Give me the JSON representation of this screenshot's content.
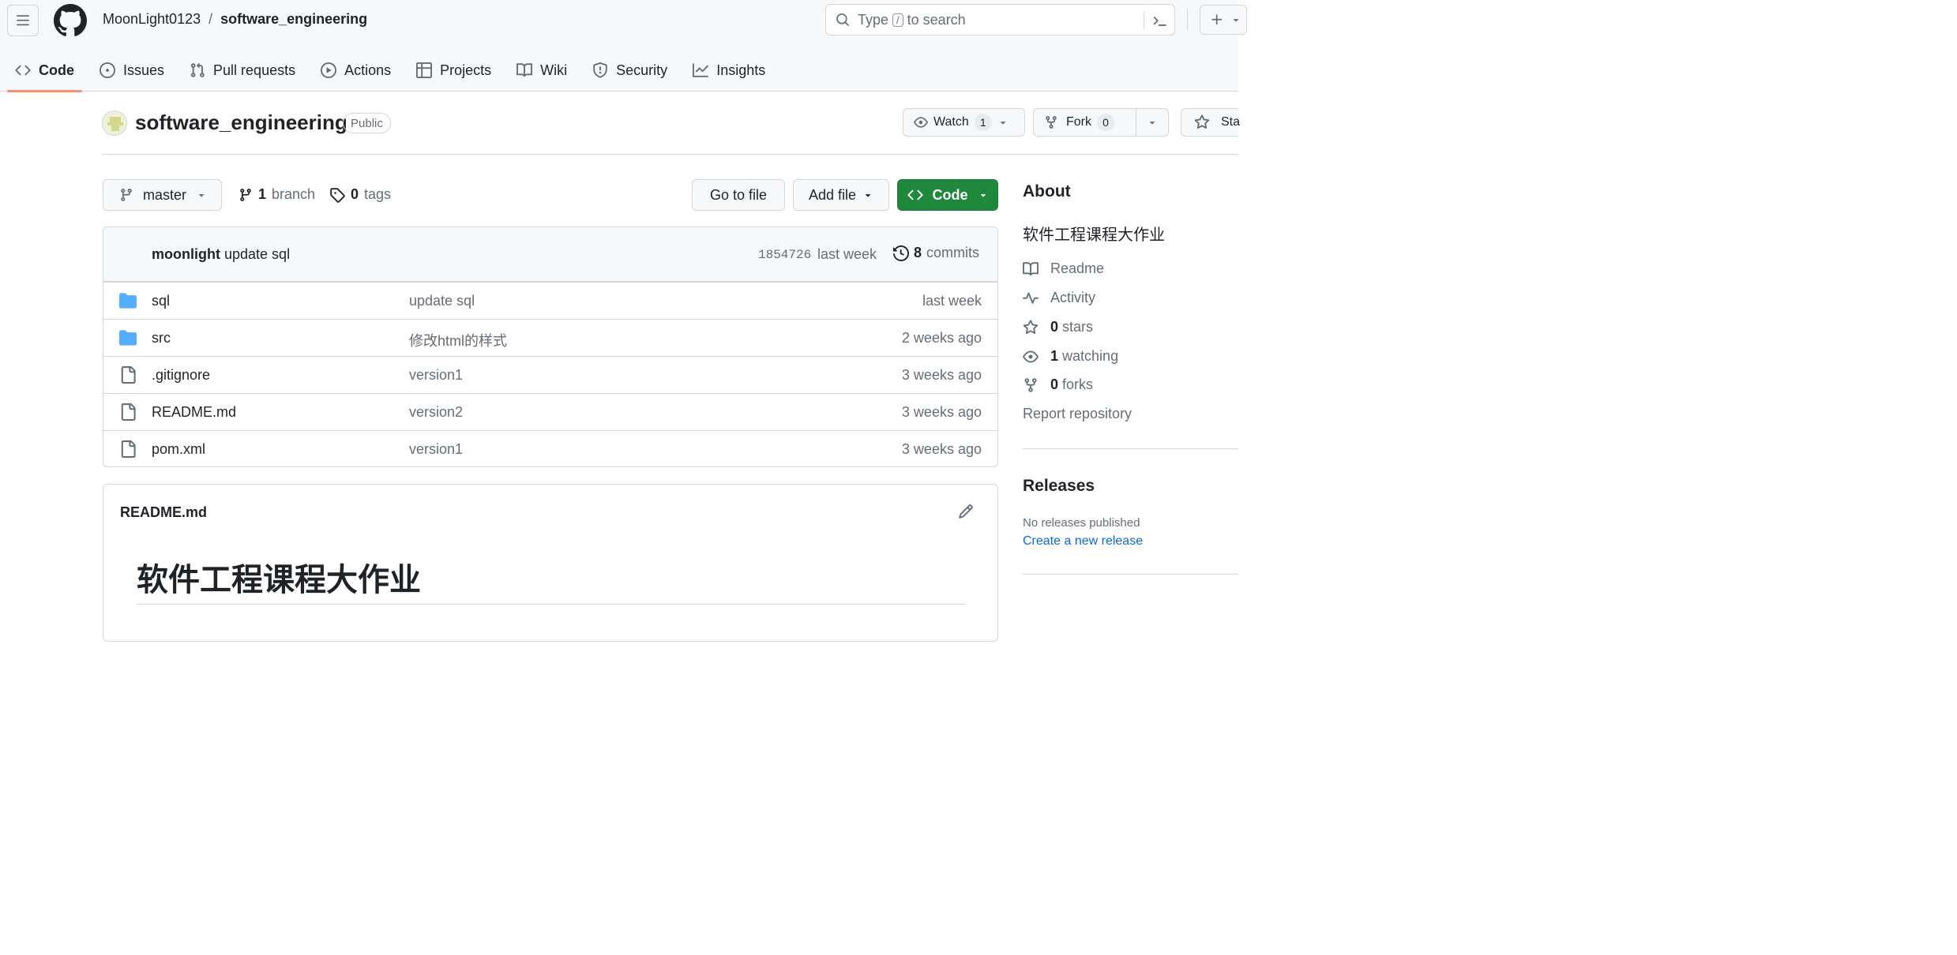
{
  "header": {
    "owner": "MoonLight0123",
    "separator": "/",
    "repo": "software_engineering",
    "search_prefix": "Type",
    "search_key": "/",
    "search_suffix": "to search"
  },
  "tabs": [
    {
      "label": "Code",
      "icon": "code-icon",
      "active": true
    },
    {
      "label": "Issues",
      "icon": "issue-icon"
    },
    {
      "label": "Pull requests",
      "icon": "pull-request-icon"
    },
    {
      "label": "Actions",
      "icon": "play-icon"
    },
    {
      "label": "Projects",
      "icon": "table-icon"
    },
    {
      "label": "Wiki",
      "icon": "book-icon"
    },
    {
      "label": "Security",
      "icon": "shield-icon"
    },
    {
      "label": "Insights",
      "icon": "graph-icon"
    }
  ],
  "repo_title": {
    "name": "software_engineering",
    "visibility": "Public",
    "watch_label": "Watch",
    "watch_count": "1",
    "fork_label": "Fork",
    "fork_count": "0",
    "star_label": "Sta"
  },
  "branch_bar": {
    "branch": "master",
    "branch_count": "1",
    "branch_label": "branch",
    "tag_count": "0",
    "tag_label": "tags",
    "go_to_file": "Go to file",
    "add_file": "Add file",
    "code": "Code"
  },
  "latest_commit": {
    "author": "moonlight",
    "message": "update sql",
    "sha": "1854726",
    "when": "last week",
    "count": "8",
    "count_label": "commits"
  },
  "files": [
    {
      "type": "folder",
      "name": "sql",
      "message": "update sql",
      "age": "last week"
    },
    {
      "type": "folder",
      "name": "src",
      "message": "修改html的样式",
      "age": "2 weeks ago"
    },
    {
      "type": "file",
      "name": ".gitignore",
      "message": "version1",
      "age": "3 weeks ago"
    },
    {
      "type": "file",
      "name": "README.md",
      "message": "version2",
      "age": "3 weeks ago"
    },
    {
      "type": "file",
      "name": "pom.xml",
      "message": "version1",
      "age": "3 weeks ago"
    }
  ],
  "readme": {
    "filename": "README.md",
    "heading": "软件工程课程大作业"
  },
  "about": {
    "title": "About",
    "description": "软件工程课程大作业",
    "readme": "Readme",
    "activity": "Activity",
    "stars_count": "0",
    "stars_label": "stars",
    "watching_count": "1",
    "watching_label": "watching",
    "forks_count": "0",
    "forks_label": "forks",
    "report": "Report repository"
  },
  "releases": {
    "title": "Releases",
    "none": "No releases published",
    "create": "Create a new release"
  },
  "colors": {
    "accent_underline": "#fd8c73",
    "code_button": "#1f883d",
    "folder": "#54aeff",
    "link": "#0969da"
  }
}
